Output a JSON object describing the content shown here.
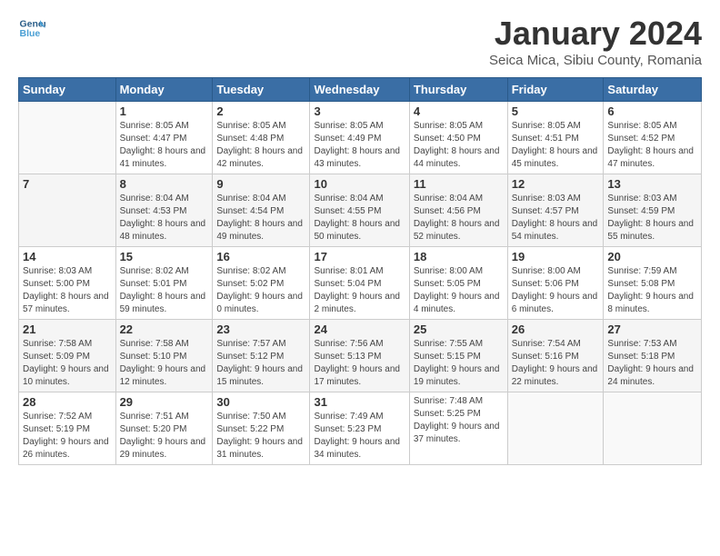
{
  "header": {
    "logo_line1": "General",
    "logo_line2": "Blue",
    "title": "January 2024",
    "subtitle": "Seica Mica, Sibiu County, Romania"
  },
  "days_of_week": [
    "Sunday",
    "Monday",
    "Tuesday",
    "Wednesday",
    "Thursday",
    "Friday",
    "Saturday"
  ],
  "weeks": [
    [
      {
        "day": "",
        "info": ""
      },
      {
        "day": "1",
        "info": "Sunrise: 8:05 AM\nSunset: 4:47 PM\nDaylight: 8 hours\nand 41 minutes."
      },
      {
        "day": "2",
        "info": "Sunrise: 8:05 AM\nSunset: 4:48 PM\nDaylight: 8 hours\nand 42 minutes."
      },
      {
        "day": "3",
        "info": "Sunrise: 8:05 AM\nSunset: 4:49 PM\nDaylight: 8 hours\nand 43 minutes."
      },
      {
        "day": "4",
        "info": "Sunrise: 8:05 AM\nSunset: 4:50 PM\nDaylight: 8 hours\nand 44 minutes."
      },
      {
        "day": "5",
        "info": "Sunrise: 8:05 AM\nSunset: 4:51 PM\nDaylight: 8 hours\nand 45 minutes."
      },
      {
        "day": "6",
        "info": "Sunrise: 8:05 AM\nSunset: 4:52 PM\nDaylight: 8 hours\nand 47 minutes."
      }
    ],
    [
      {
        "day": "7",
        "info": ""
      },
      {
        "day": "8",
        "info": "Sunrise: 8:04 AM\nSunset: 4:53 PM\nDaylight: 8 hours\nand 48 minutes."
      },
      {
        "day": "9",
        "info": "Sunrise: 8:04 AM\nSunset: 4:54 PM\nDaylight: 8 hours\nand 49 minutes."
      },
      {
        "day": "10",
        "info": "Sunrise: 8:04 AM\nSunset: 4:55 PM\nDaylight: 8 hours\nand 50 minutes."
      },
      {
        "day": "11",
        "info": "Sunrise: 8:04 AM\nSunset: 4:56 PM\nDaylight: 8 hours\nand 52 minutes."
      },
      {
        "day": "12",
        "info": "Sunrise: 8:03 AM\nSunset: 4:57 PM\nDaylight: 8 hours\nand 54 minutes."
      },
      {
        "day": "13",
        "info": "Sunrise: 8:03 AM\nSunset: 4:59 PM\nDaylight: 8 hours\nand 55 minutes."
      }
    ],
    [
      {
        "day": "14",
        "info": "Sunrise: 8:03 AM\nSunset: 5:00 PM\nDaylight: 8 hours\nand 57 minutes."
      },
      {
        "day": "15",
        "info": "Sunrise: 8:02 AM\nSunset: 5:01 PM\nDaylight: 8 hours\nand 59 minutes."
      },
      {
        "day": "16",
        "info": "Sunrise: 8:02 AM\nSunset: 5:02 PM\nDaylight: 9 hours\nand 0 minutes."
      },
      {
        "day": "17",
        "info": "Sunrise: 8:01 AM\nSunset: 5:04 PM\nDaylight: 9 hours\nand 2 minutes."
      },
      {
        "day": "18",
        "info": "Sunrise: 8:00 AM\nSunset: 5:05 PM\nDaylight: 9 hours\nand 4 minutes."
      },
      {
        "day": "19",
        "info": "Sunrise: 8:00 AM\nSunset: 5:06 PM\nDaylight: 9 hours\nand 6 minutes."
      },
      {
        "day": "20",
        "info": "Sunrise: 7:59 AM\nSunset: 5:08 PM\nDaylight: 9 hours\nand 8 minutes."
      }
    ],
    [
      {
        "day": "21",
        "info": "Sunrise: 7:58 AM\nSunset: 5:09 PM\nDaylight: 9 hours\nand 10 minutes."
      },
      {
        "day": "22",
        "info": "Sunrise: 7:58 AM\nSunset: 5:10 PM\nDaylight: 9 hours\nand 12 minutes."
      },
      {
        "day": "23",
        "info": "Sunrise: 7:57 AM\nSunset: 5:12 PM\nDaylight: 9 hours\nand 15 minutes."
      },
      {
        "day": "24",
        "info": "Sunrise: 7:56 AM\nSunset: 5:13 PM\nDaylight: 9 hours\nand 17 minutes."
      },
      {
        "day": "25",
        "info": "Sunrise: 7:55 AM\nSunset: 5:15 PM\nDaylight: 9 hours\nand 19 minutes."
      },
      {
        "day": "26",
        "info": "Sunrise: 7:54 AM\nSunset: 5:16 PM\nDaylight: 9 hours\nand 22 minutes."
      },
      {
        "day": "27",
        "info": "Sunrise: 7:53 AM\nSunset: 5:18 PM\nDaylight: 9 hours\nand 24 minutes."
      }
    ],
    [
      {
        "day": "28",
        "info": "Sunrise: 7:52 AM\nSunset: 5:19 PM\nDaylight: 9 hours\nand 26 minutes."
      },
      {
        "day": "29",
        "info": "Sunrise: 7:51 AM\nSunset: 5:20 PM\nDaylight: 9 hours\nand 29 minutes."
      },
      {
        "day": "30",
        "info": "Sunrise: 7:50 AM\nSunset: 5:22 PM\nDaylight: 9 hours\nand 31 minutes."
      },
      {
        "day": "31",
        "info": "Sunrise: 7:49 AM\nSunset: 5:23 PM\nDaylight: 9 hours\nand 34 minutes."
      },
      {
        "day": "",
        "info": "Sunrise: 7:48 AM\nSunset: 5:25 PM\nDaylight: 9 hours\nand 37 minutes."
      },
      {
        "day": "",
        "info": ""
      },
      {
        "day": "",
        "info": ""
      }
    ]
  ]
}
